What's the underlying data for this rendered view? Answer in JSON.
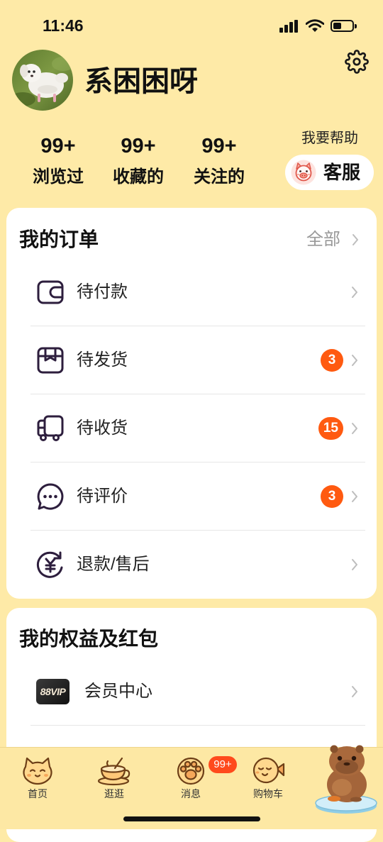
{
  "status_bar": {
    "time": "11:46",
    "battery_level": 0.45
  },
  "profile": {
    "username": "系困困呀"
  },
  "stats": [
    {
      "value": "99+",
      "label": "浏览过"
    },
    {
      "value": "99+",
      "label": "收藏的"
    },
    {
      "value": "99+",
      "label": "关注的"
    }
  ],
  "help": {
    "label": "我要帮助",
    "service_label": "客服",
    "service_icon": "pig-mascot-icon"
  },
  "orders": {
    "title": "我的订单",
    "all_label": "全部",
    "items": [
      {
        "label": "待付款",
        "icon": "wallet-icon"
      },
      {
        "label": "待发货",
        "icon": "package-icon",
        "badge": "3"
      },
      {
        "label": "待收货",
        "icon": "truck-icon",
        "badge": "15"
      },
      {
        "label": "待评价",
        "icon": "chat-bubble-icon",
        "badge": "3"
      },
      {
        "label": "退款/售后",
        "icon": "refund-yen-icon"
      }
    ]
  },
  "benefits": {
    "title": "我的权益及红包",
    "items": [
      {
        "label": "会员中心",
        "icon_text": "88VIP"
      }
    ]
  },
  "tab_bar": {
    "items": [
      {
        "label": "首页",
        "icon": "cat-face-icon"
      },
      {
        "label": "逛逛",
        "icon": "teacup-icon"
      },
      {
        "label": "消息",
        "icon": "paw-icon",
        "badge": "99+"
      },
      {
        "label": "购物车",
        "icon": "fish-face-icon"
      }
    ],
    "profile_icon": "capybara-icon"
  },
  "colors": {
    "page_background": "#FEEAA7",
    "card_background": "#FFFFFF",
    "order_icon": "#2D1E3D",
    "badge": "#FF5A10",
    "tab_badge": "#FF4A1C",
    "muted_text": "#999999"
  }
}
